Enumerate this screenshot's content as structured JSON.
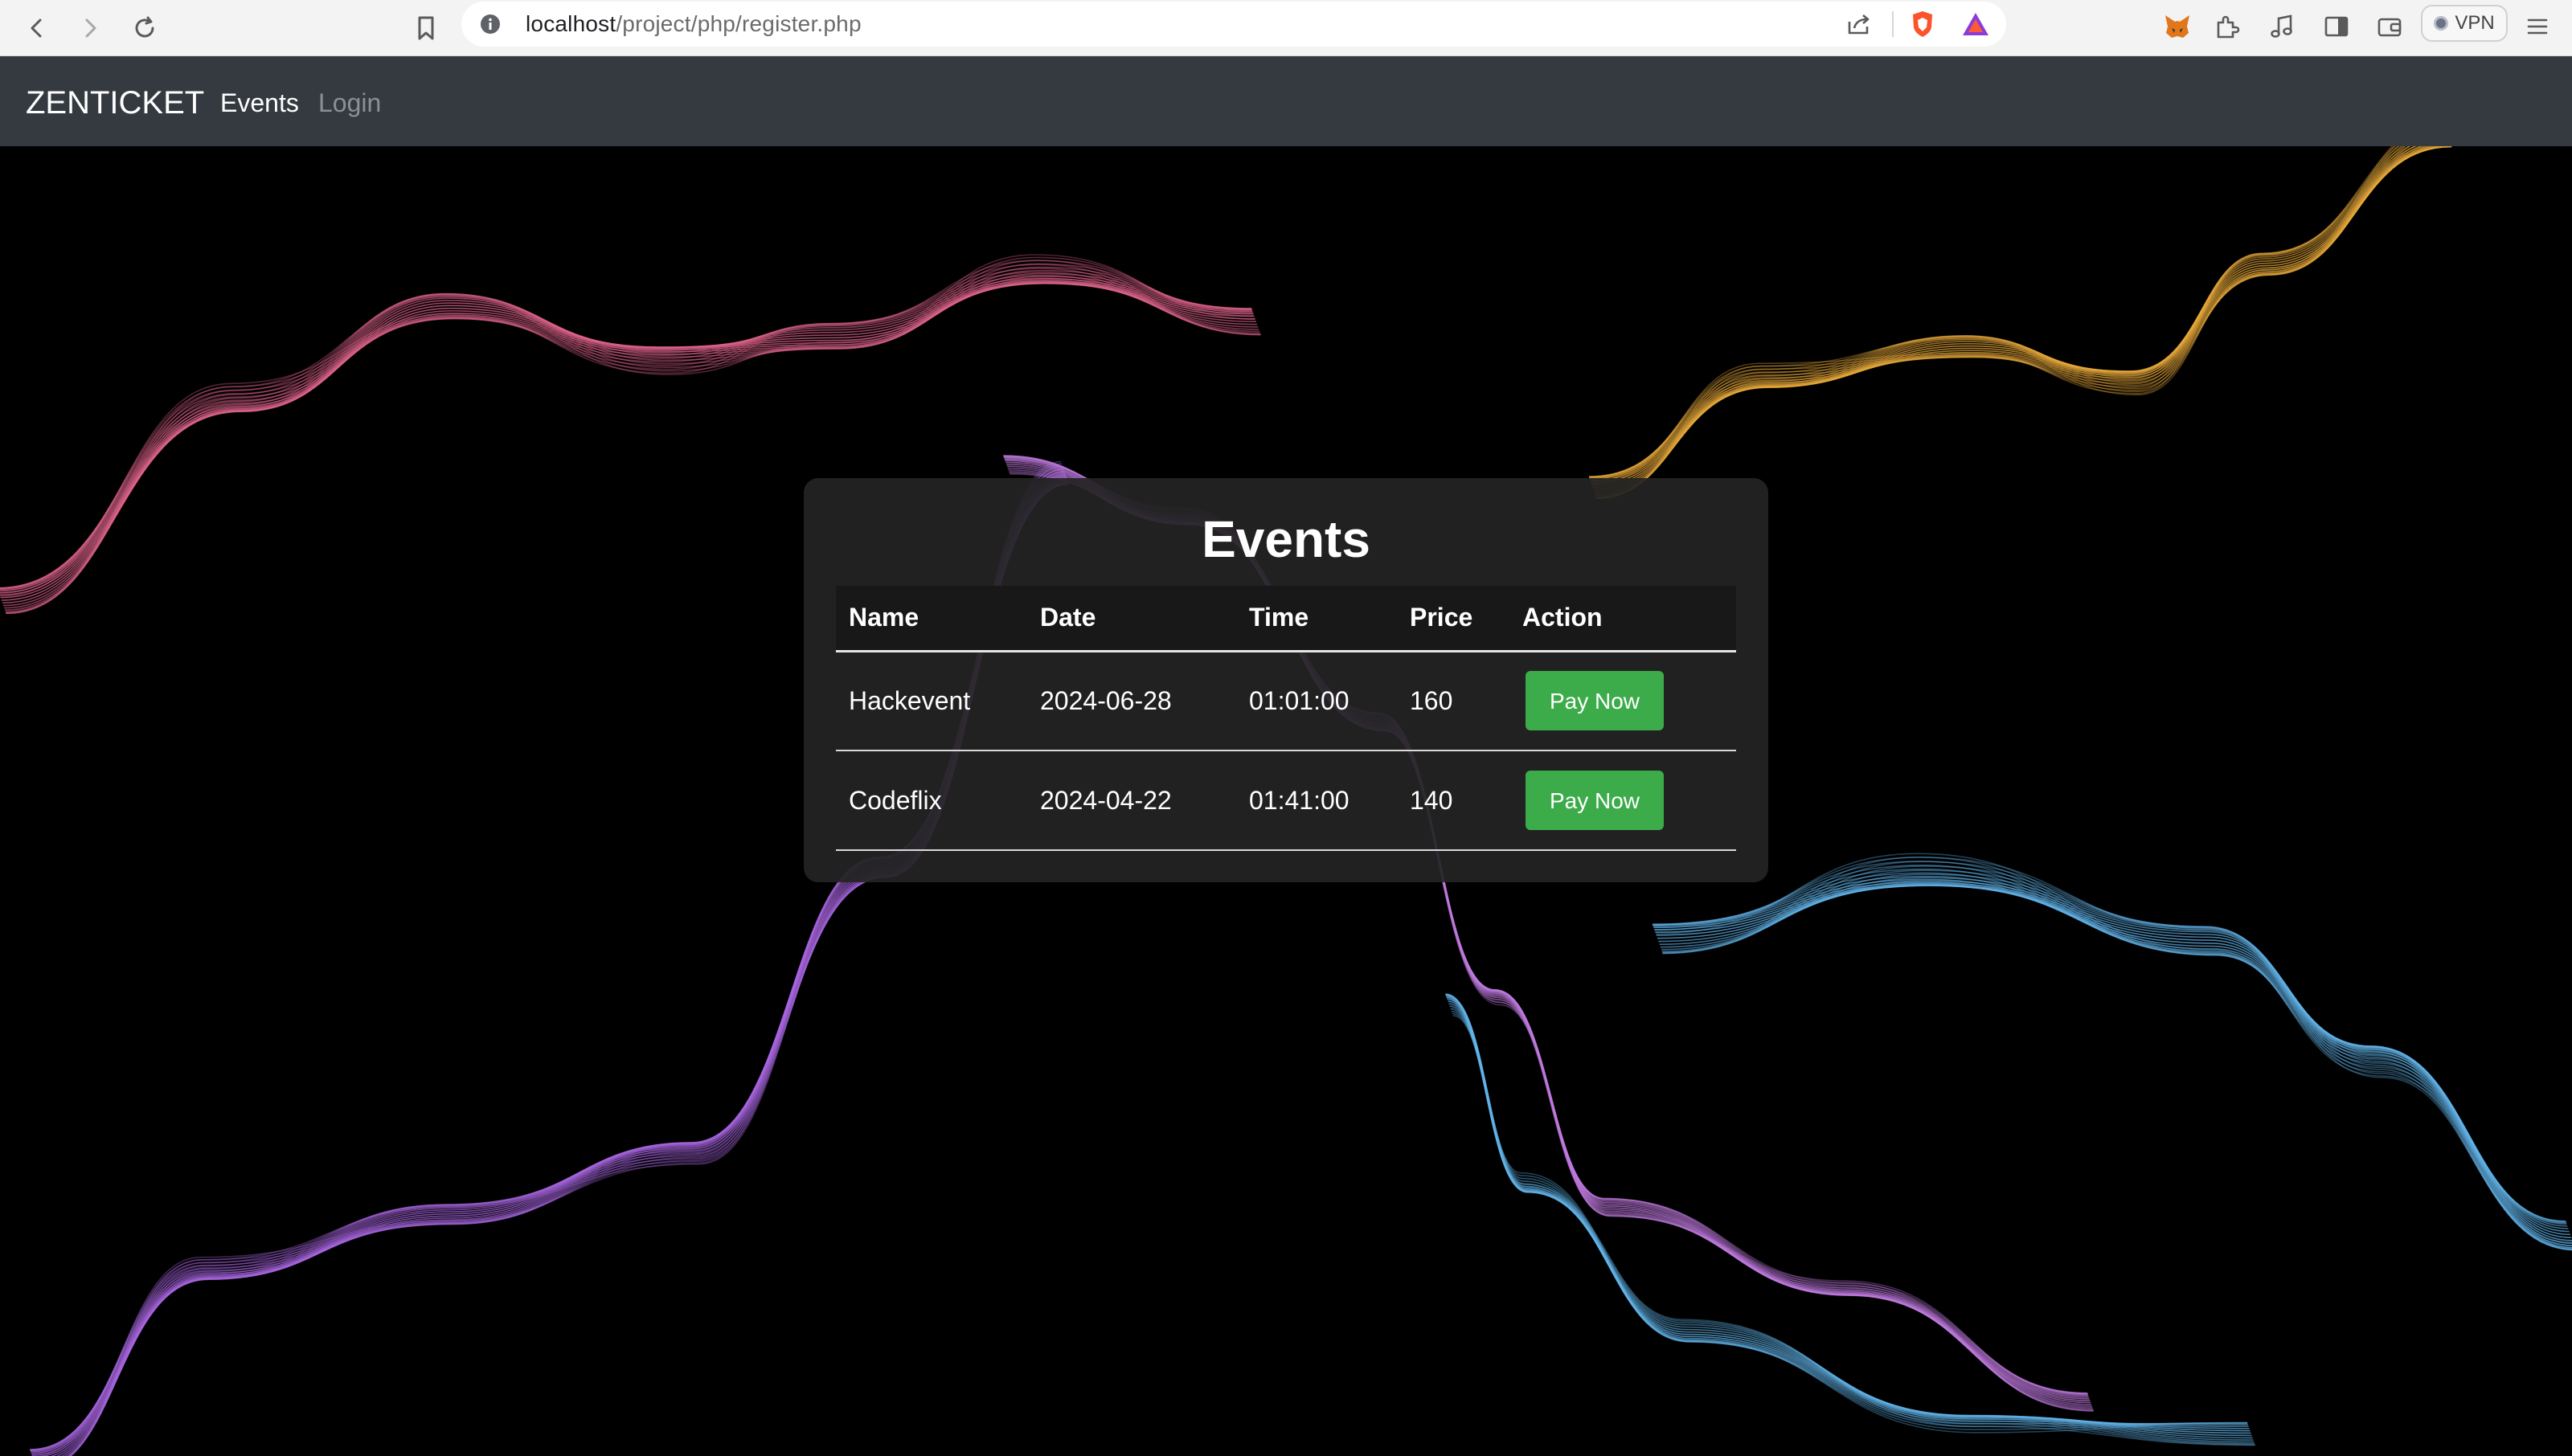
{
  "browser": {
    "url_host": "localhost",
    "url_path": "/project/php/register.php",
    "vpn_label": "VPN",
    "icons": [
      "back-icon",
      "forward-icon",
      "reload-icon",
      "bookmark-icon",
      "info-icon",
      "share-icon",
      "brave-shield-icon",
      "brave-rewards-icon",
      "metamask-icon",
      "extensions-icon",
      "media-icon",
      "sidebar-icon",
      "wallet-icon",
      "menu-icon"
    ]
  },
  "navbar": {
    "brand": "ZENTICKET",
    "links": [
      {
        "label": "Events",
        "active": true
      },
      {
        "label": "Login",
        "active": false
      }
    ]
  },
  "events": {
    "title": "Events",
    "columns": [
      "Name",
      "Date",
      "Time",
      "Price",
      "Action"
    ],
    "rows": [
      {
        "name": "Hackevent",
        "date": "2024-06-28",
        "time": "01:01:00",
        "price": "160",
        "action": "Pay Now"
      },
      {
        "name": "Codeflix",
        "date": "2024-04-22",
        "time": "01:41:00",
        "price": "140",
        "action": "Pay Now"
      }
    ]
  },
  "colors": {
    "navbar_bg": "#343a40",
    "card_bg": "#242424",
    "button_green": "#3cab4a",
    "wave_pink": "#e0648c",
    "wave_gold": "#e8a93a",
    "wave_purple": "#a866e0",
    "wave_blue": "#62b4ea"
  }
}
